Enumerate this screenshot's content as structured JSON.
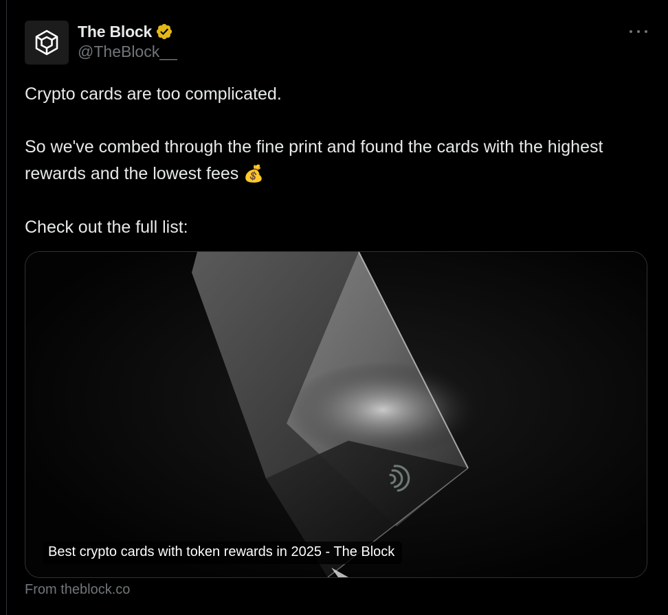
{
  "author": {
    "display_name": "The Block",
    "handle": "@TheBlock__",
    "verified_badge_color": "#e2b719",
    "avatar_icon": "the-block-cube-logo"
  },
  "menu": {
    "icon": "more-horizontal-icon"
  },
  "tweet": {
    "line1": "Crypto cards are too complicated.",
    "line2": "So we've combed through the fine print and found the cards with the highest rewards and the lowest fees ",
    "emoji": "💰",
    "line3": "Check out the full list:"
  },
  "link_card": {
    "caption": "Best crypto cards with token rewards in 2025 - The Block",
    "source": "From theblock.co",
    "image_icon": "contactless-payment-icon"
  },
  "colors": {
    "background": "#000000",
    "text": "#e7e9ea",
    "secondary_text": "#71767b",
    "border": "#2f3336"
  }
}
